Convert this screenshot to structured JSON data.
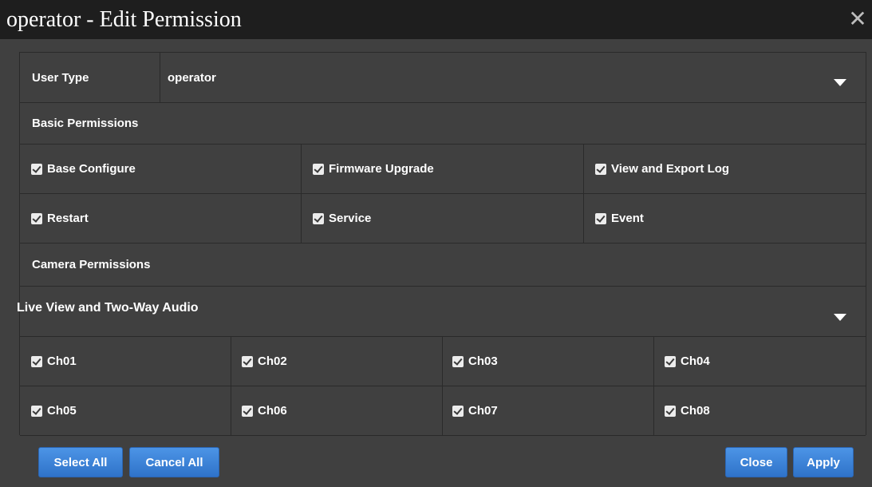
{
  "dialog": {
    "title": "operator - Edit Permission",
    "close_glyph": "✕"
  },
  "user_type": {
    "label": "User Type",
    "value": "operator"
  },
  "basic_permissions": {
    "header": "Basic Permissions",
    "items": [
      {
        "label": "Base Configure",
        "checked": true
      },
      {
        "label": "Firmware Upgrade",
        "checked": true
      },
      {
        "label": "View and Export Log",
        "checked": true
      },
      {
        "label": "Restart",
        "checked": true
      },
      {
        "label": "Service",
        "checked": true
      },
      {
        "label": "Event",
        "checked": true
      }
    ]
  },
  "camera_permissions": {
    "header": "Camera Permissions",
    "selected_type": "Live View and Two-Way Audio",
    "channels": [
      {
        "label": "Ch01",
        "checked": true
      },
      {
        "label": "Ch02",
        "checked": true
      },
      {
        "label": "Ch03",
        "checked": true
      },
      {
        "label": "Ch04",
        "checked": true
      },
      {
        "label": "Ch05",
        "checked": true
      },
      {
        "label": "Ch06",
        "checked": true
      },
      {
        "label": "Ch07",
        "checked": true
      },
      {
        "label": "Ch08",
        "checked": true
      }
    ]
  },
  "buttons": {
    "select_all": "Select All",
    "cancel_all": "Cancel All",
    "close": "Close",
    "apply": "Apply"
  },
  "colors": {
    "dialog_bg": "#404040",
    "titlebar_bg": "#1e1e1e",
    "button_blue": "#3d84dc",
    "text": "#ffffff"
  }
}
